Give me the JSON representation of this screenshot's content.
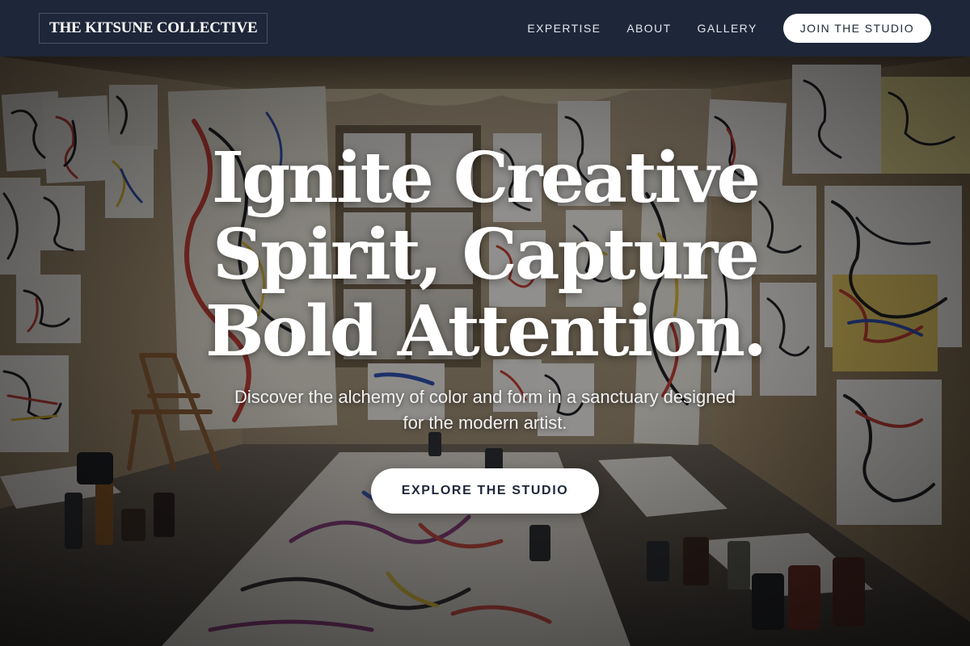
{
  "header": {
    "logo_text": "THE KITSUNE COLLECTIVE",
    "nav": [
      {
        "label": "EXPERTISE"
      },
      {
        "label": "ABOUT"
      },
      {
        "label": "GALLERY"
      }
    ],
    "cta_label": "JOIN THE STUDIO"
  },
  "hero": {
    "headline_lines": [
      "Ignite Creative",
      "Spirit, Capture",
      "Bold Attention."
    ],
    "subtitle": "Discover the alchemy of color and form in a sanctuary designed for the modern artist.",
    "cta_label": "EXPLORE THE STUDIO"
  },
  "colors": {
    "header_bg": "#1e2739",
    "button_bg": "#ffffff",
    "button_text": "#1e2739",
    "text_light": "#ffffff"
  }
}
